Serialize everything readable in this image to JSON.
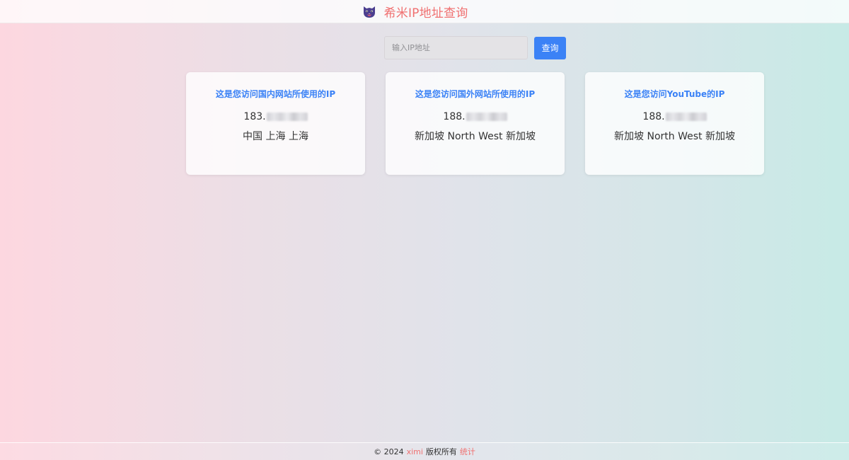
{
  "header": {
    "title": "希米IP地址查询",
    "logo_icon": "cat-face-icon"
  },
  "search": {
    "placeholder": "输入IP地址",
    "value": "",
    "button_label": "查询"
  },
  "cards": [
    {
      "title": "这是您访问国内网站所使用的IP",
      "ip_prefix": "183.",
      "location": "中国 上海 上海"
    },
    {
      "title": "这是您访问国外网站所使用的IP",
      "ip_prefix": "188.",
      "location": "新加坡 North West 新加坡"
    },
    {
      "title": "这是您访问YouTube的IP",
      "ip_prefix": "188.",
      "location": "新加坡 North West 新加坡"
    }
  ],
  "footer": {
    "copyright": "© 2024",
    "brand": "ximi",
    "rights": "版权所有",
    "stats_link": "统计"
  },
  "colors": {
    "accent_blue": "#3b82f6",
    "accent_pink": "#f07070",
    "bg_left": "#fdd7e0",
    "bg_right": "#c7eae6"
  }
}
